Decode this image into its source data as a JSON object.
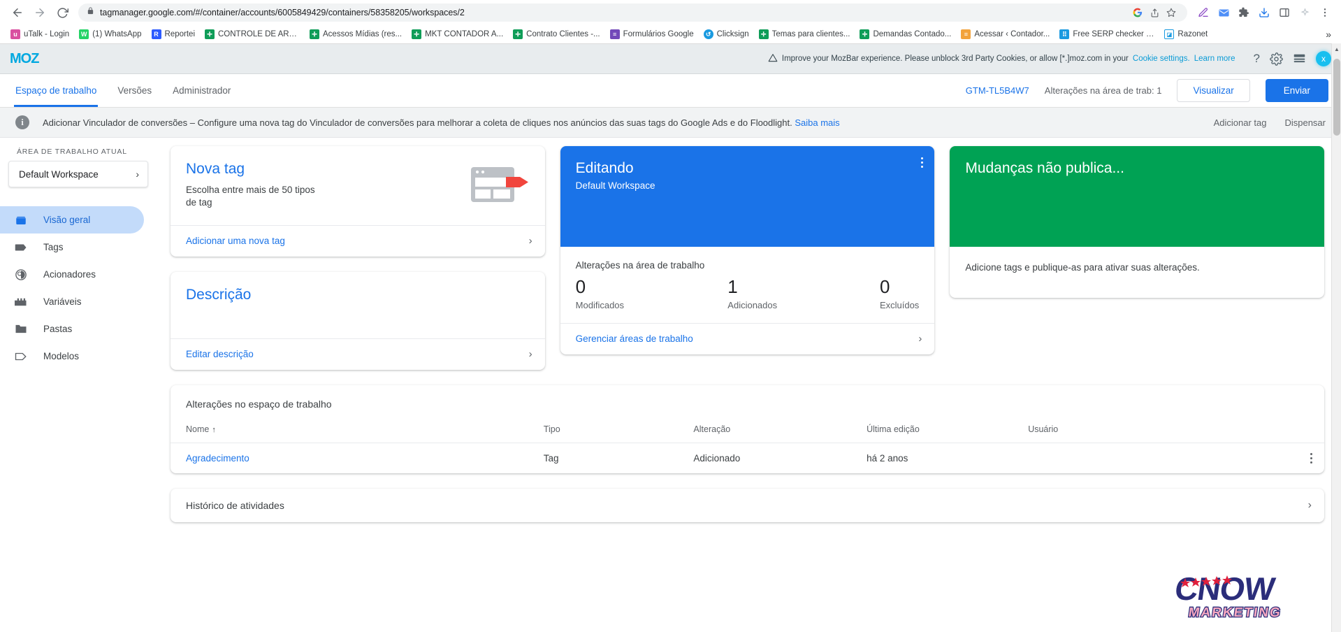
{
  "browser": {
    "url": "tagmanager.google.com/#/container/accounts/6005849429/containers/58358205/workspaces/2",
    "back_icon": "back-arrow-icon",
    "forward_icon": "forward-arrow-icon",
    "reload_icon": "reload-icon",
    "lock_icon": "lock-icon",
    "bookmarks": [
      {
        "label": "uTalk - Login",
        "color": "#d94fa0",
        "glyph": "u"
      },
      {
        "label": "(1) WhatsApp",
        "color": "#25d366",
        "glyph": "W"
      },
      {
        "label": "Reportei",
        "color": "#2d5bff",
        "glyph": "R"
      },
      {
        "label": "CONTROLE DE ARTI...",
        "color": "#0f9d58",
        "glyph": "+"
      },
      {
        "label": "Acessos Mídias (res...",
        "color": "#0f9d58",
        "glyph": "+"
      },
      {
        "label": "MKT CONTADOR A...",
        "color": "#0f9d58",
        "glyph": "+"
      },
      {
        "label": "Contrato Clientes -...",
        "color": "#0f9d58",
        "glyph": "+"
      },
      {
        "label": "Formulários Google",
        "color": "#7248b9",
        "glyph": "≡"
      },
      {
        "label": "Clicksign",
        "color": "#1a9ae0",
        "glyph": "C"
      },
      {
        "label": "Temas para clientes...",
        "color": "#0f9d58",
        "glyph": "+"
      },
      {
        "label": "Demandas Contado...",
        "color": "#0f9d58",
        "glyph": "+"
      },
      {
        "label": "Acessar ‹ Contador...",
        "color": "#f2a33c",
        "glyph": "≡"
      },
      {
        "label": "Free SERP checker -...",
        "color": "#1a9ae0",
        "glyph": "⠿"
      },
      {
        "label": "Razonet",
        "color": "#1a9ae0",
        "glyph": "◪"
      }
    ],
    "bookmarks_overflow": "»",
    "toolbar_icons": [
      "share-icon",
      "bookmark-star-icon",
      "pen-icon",
      "mail-icon",
      "extensions-icon",
      "download-icon",
      "sidepanel-icon",
      "sparkle-icon",
      "menu-icon"
    ],
    "google-icon": "google-g-icon"
  },
  "mozbar": {
    "logo": "MOZ",
    "warning_icon": "warning-triangle-icon",
    "message": "Improve your MozBar experience. Please unblock 3rd Party Cookies, or allow [*.]moz.com in your",
    "cookie_settings_link": "Cookie settings.",
    "learn_more_link": "Learn more",
    "help_icon": "?",
    "gear_icon": "gear-icon",
    "bar_icon": "layers-icon",
    "avatar_initial": "x",
    "accent": "#00a8e0"
  },
  "gtm": {
    "tabs": [
      {
        "label": "Espaço de trabalho",
        "active": true
      },
      {
        "label": "Versões",
        "active": false
      },
      {
        "label": "Administrador",
        "active": false
      }
    ],
    "container_id": "GTM-TL5B4W7",
    "changes_label": "Alterações na área de trab: 1",
    "preview_button": "Visualizar",
    "submit_button": "Enviar"
  },
  "notice": {
    "title": "Adicionar Vinculador de conversões",
    "dash": "–",
    "text": "Configure uma nova tag do Vinculador de conversões para melhorar a coleta de cliques nos anúncios das suas tags do Google Ads e do Floodlight.",
    "link": "Saiba mais",
    "action_add": "Adicionar tag",
    "action_dismiss": "Dispensar"
  },
  "sidebar": {
    "section_label": "ÁREA DE TRABALHO ATUAL",
    "workspace_name": "Default Workspace",
    "items": [
      {
        "label": "Visão geral",
        "icon": "overview-icon",
        "active": true
      },
      {
        "label": "Tags",
        "icon": "tag-icon",
        "active": false
      },
      {
        "label": "Acionadores",
        "icon": "trigger-icon",
        "active": false
      },
      {
        "label": "Variáveis",
        "icon": "variables-icon",
        "active": false
      },
      {
        "label": "Pastas",
        "icon": "folder-icon",
        "active": false
      },
      {
        "label": "Modelos",
        "icon": "template-icon",
        "active": false
      }
    ]
  },
  "cards": {
    "new_tag": {
      "title": "Nova tag",
      "subtitle": "Escolha entre mais de 50 tipos de tag",
      "action": "Adicionar uma nova tag"
    },
    "description": {
      "title": "Descrição",
      "action": "Editar descrição"
    },
    "editing": {
      "title": "Editando",
      "subtitle": "Default Workspace",
      "stats_title": "Alterações na área de trabalho",
      "stats": [
        {
          "value": "0",
          "label": "Modificados"
        },
        {
          "value": "1",
          "label": "Adicionados"
        },
        {
          "value": "0",
          "label": "Excluídos"
        }
      ],
      "action": "Gerenciar áreas de trabalho",
      "color": "#1a73e8"
    },
    "unpublished": {
      "title": "Mudanças não publica...",
      "body": "Adicione tags e publique-as para ativar suas alterações.",
      "color": "#00a254"
    }
  },
  "changes_table": {
    "title": "Alterações no espaço de trabalho",
    "columns": [
      "Nome",
      "Tipo",
      "Alteração",
      "Última edição",
      "Usuário"
    ],
    "sort_arrow": "↑",
    "rows": [
      {
        "name": "Agradecimento",
        "type": "Tag",
        "change": "Adicionado",
        "last_edit": "há 2 anos",
        "user": ""
      }
    ]
  },
  "activity": {
    "title": "Histórico de atividades"
  },
  "watermark": {
    "brand": "CNOW",
    "tagline": "MARKETING"
  }
}
